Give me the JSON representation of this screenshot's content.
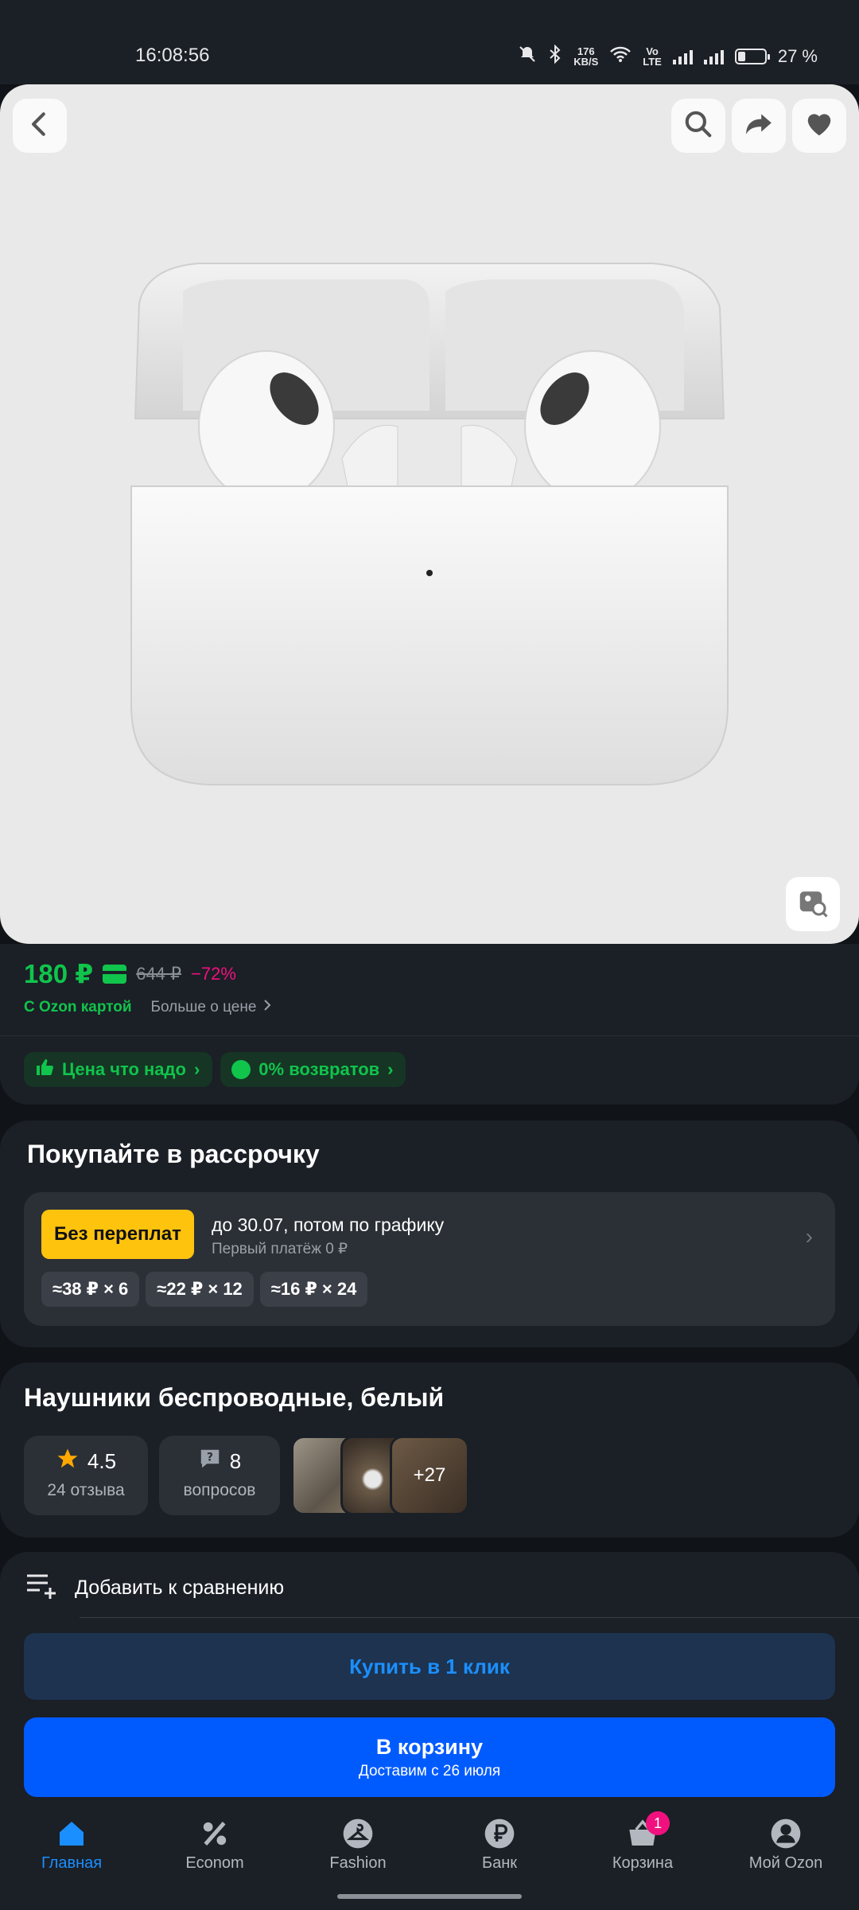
{
  "status_bar": {
    "time": "16:08:56",
    "speed_value": "176",
    "speed_unit": "KB/S",
    "network_vo": "Vo",
    "network_lte": "LTE",
    "battery": "27 %"
  },
  "product_image": {
    "background": "#e9e9e9",
    "buttons": [
      "back-icon",
      "search-icon",
      "share-icon",
      "heart-icon",
      "visual-search-icon"
    ]
  },
  "price": {
    "current": "180 ₽",
    "old": "644 ₽",
    "discount": "−72%",
    "ozon_card": "С Ozon картой",
    "more_about_price": "Больше о цене",
    "chips": [
      "Цена что надо",
      "0% возвратов"
    ]
  },
  "installment": {
    "title": "Покупайте в рассрочку",
    "badge": "Без переплат",
    "line1": "до 30.07, потом по графику",
    "line2": "Первый платёж 0 ₽",
    "options": [
      "≈38 ₽ × 6",
      "≈22 ₽ × 12",
      "≈16 ₽ × 24"
    ]
  },
  "product": {
    "title": "Наушники беспроводные, белый",
    "rating": "4.5",
    "reviews": "24 отзыва",
    "questions_count": "8",
    "questions_label": "вопросов",
    "more_photos": "+27"
  },
  "actions": {
    "compare": "Добавить к сравнению",
    "buy_one_click": "Купить в 1 клик",
    "cart": "В корзину",
    "delivery": "Доставим с 26 июля"
  },
  "nav": {
    "items": [
      "Главная",
      "Econom",
      "Fashion",
      "Банк",
      "Корзина",
      "Мой Ozon"
    ],
    "cart_badge": "1",
    "active_color": "#1a8fff"
  },
  "colors": {
    "price_green": "#10c44c",
    "discount_pink": "#f1117e",
    "installment_yellow": "#fec30d",
    "cart_blue": "#005bff"
  }
}
